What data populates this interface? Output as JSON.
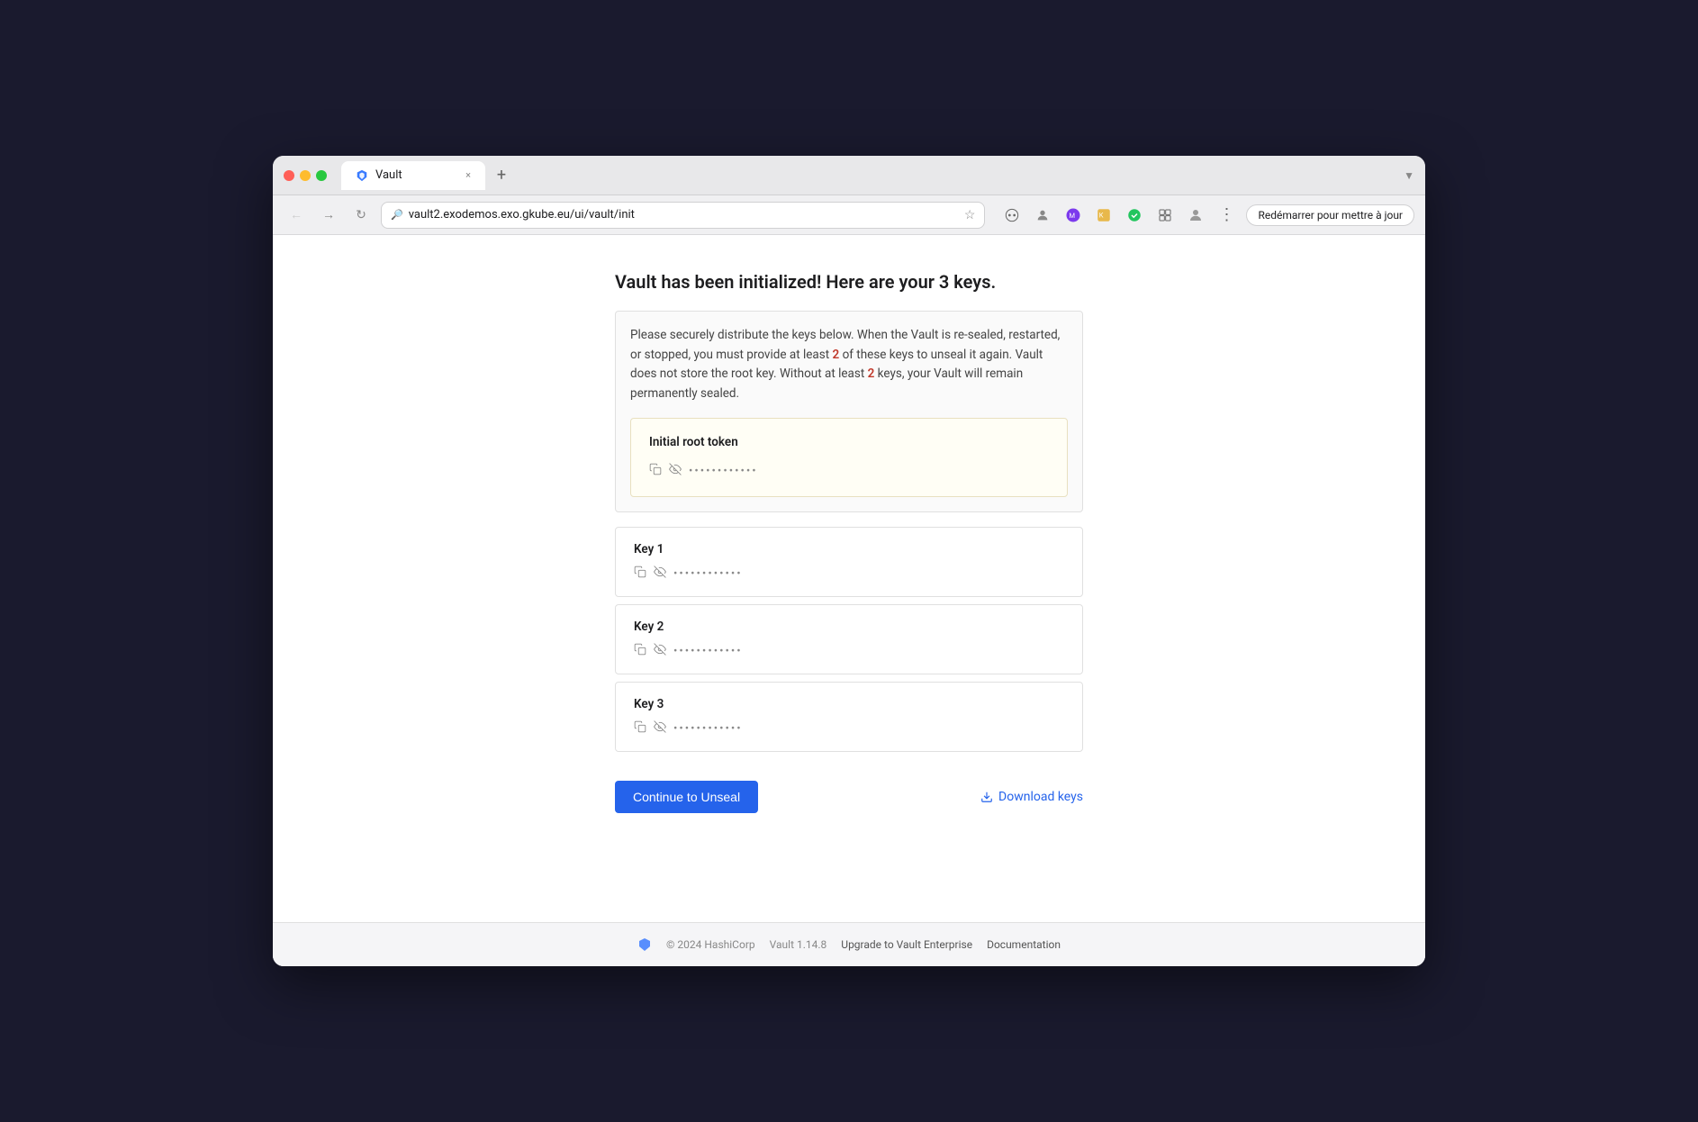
{
  "browser": {
    "tab_title": "Vault",
    "tab_close": "×",
    "tab_new": "+",
    "url": "vault2.exodemos.exo.gkube.eu/ui/vault/init",
    "update_btn": "Redémarrer pour mettre à jour",
    "nav_dropdown": "▼"
  },
  "page": {
    "title": "Vault has been initialized! Here are your 3 keys.",
    "info_text_1": "Please securely distribute the keys below. When the Vault is re-sealed, restarted, or stopped, you must provide at least ",
    "info_highlight_1": "2",
    "info_text_2": " of these keys to unseal it again. Vault does not store the root key. Without at least ",
    "info_highlight_2": "2",
    "info_text_3": " keys, your Vault will remain permanently sealed."
  },
  "initial_root_token": {
    "label": "Initial root token",
    "masked": "••••••••••••"
  },
  "keys": [
    {
      "label": "Key 1",
      "masked": "••••••••••••"
    },
    {
      "label": "Key 2",
      "masked": "••••••••••••"
    },
    {
      "label": "Key 3",
      "masked": "••••••••••••"
    }
  ],
  "actions": {
    "continue_label": "Continue to Unseal",
    "download_label": "Download keys"
  },
  "footer": {
    "copyright": "© 2024 HashiCorp",
    "version": "Vault 1.14.8",
    "enterprise_link": "Upgrade to Vault Enterprise",
    "docs_link": "Documentation"
  }
}
